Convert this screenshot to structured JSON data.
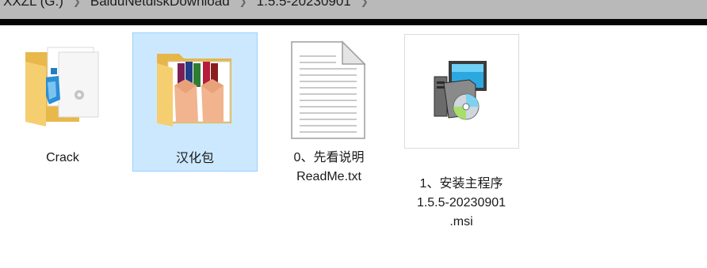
{
  "address_bar": {
    "crumbs": [
      "XXZL (G:)",
      "BaiduNetdiskDownload",
      "1.5.5-20230901"
    ]
  },
  "items": [
    {
      "label_lines": [
        "Crack"
      ],
      "icon": "folder-icon",
      "selected": false
    },
    {
      "label_lines": [
        "汉化包"
      ],
      "icon": "folder-books-icon",
      "selected": true
    },
    {
      "label_lines": [
        "0、先看说明",
        "ReadMe.txt"
      ],
      "icon": "text-document-icon",
      "selected": false
    },
    {
      "label_lines": [
        "1、安装主程序",
        "1.5.5-20230901",
        ".msi"
      ],
      "icon": "msi-installer-icon",
      "selected": false
    }
  ],
  "colors": {
    "selection_bg": "#cce8ff",
    "selection_border": "#99d1ff",
    "address_bar_bg": "#b9b9b9"
  }
}
